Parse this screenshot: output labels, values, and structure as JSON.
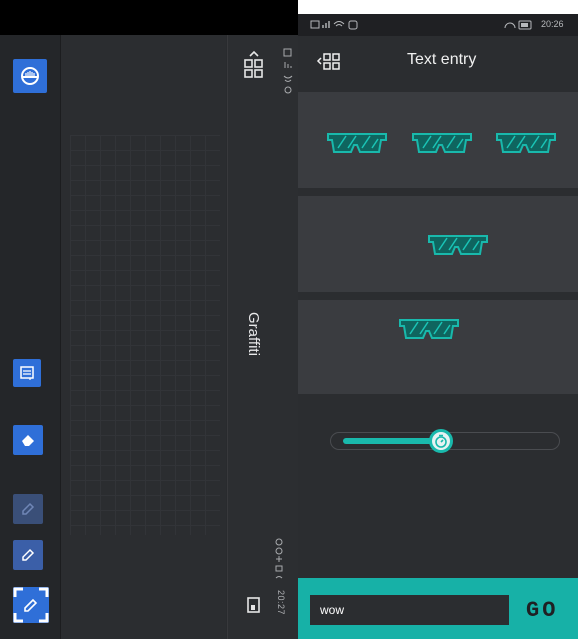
{
  "left_capture": {
    "side_title": "Graffiti",
    "status_text": "20:27",
    "tools": [
      {
        "name": "joystick"
      },
      {
        "name": "text-tool"
      },
      {
        "name": "eraser-tool"
      },
      {
        "name": "pencil-tool"
      },
      {
        "name": "pencil-tool"
      },
      {
        "name": "pencil-tool-selected"
      }
    ]
  },
  "phone": {
    "status_time": "20:26",
    "header_title": "Text entry",
    "slider_percent": 45,
    "text_input_value": "wow",
    "go_label": "GO",
    "accent_color": "#17b1a7",
    "card_background": "#3a3c40"
  }
}
